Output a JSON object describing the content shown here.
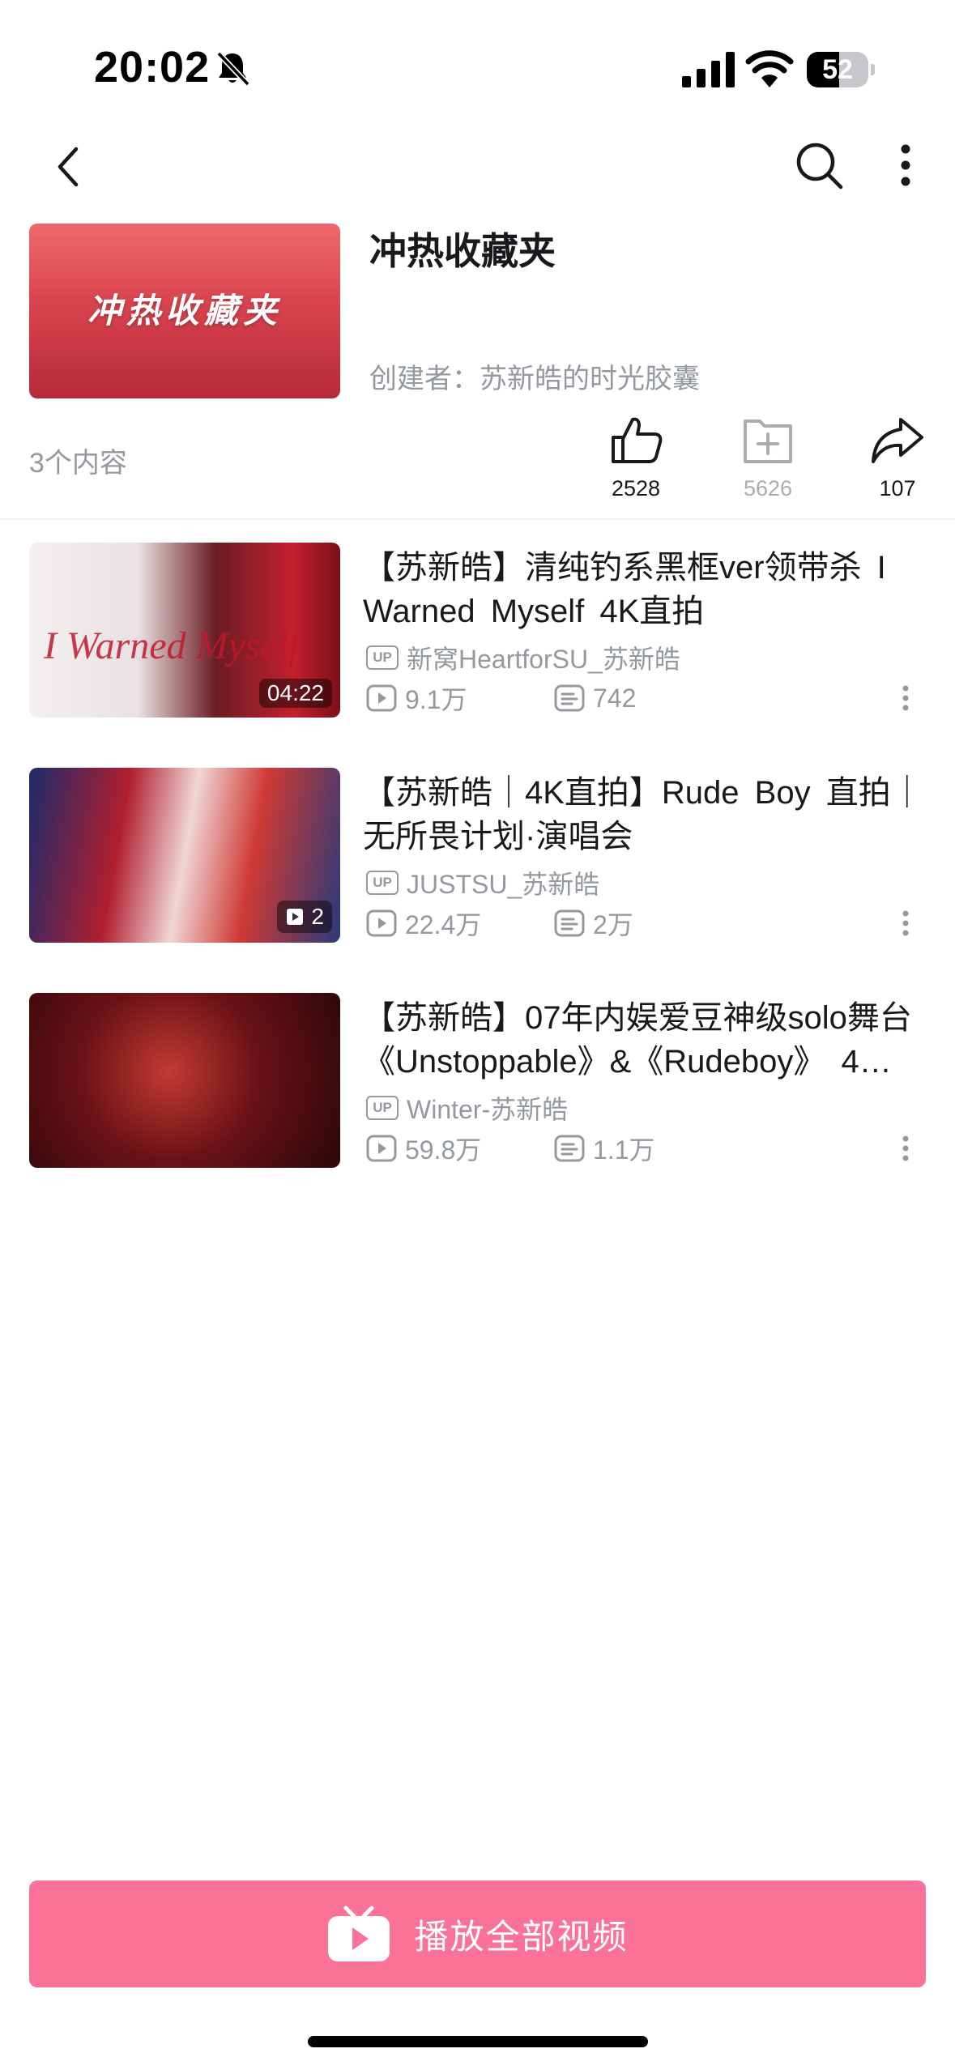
{
  "status_bar": {
    "time": "20:02",
    "battery": "52",
    "battery_level": 0.52,
    "icons": [
      "bell-muted-icon",
      "cellular-signal-icon",
      "wifi-icon",
      "battery-icon"
    ]
  },
  "nav": {
    "icons": [
      "back-arrow-icon",
      "search-icon",
      "more-vertical-icon"
    ]
  },
  "folder": {
    "cover_text": "冲热收藏夹",
    "title": "冲热收藏夹",
    "creator": "创建者：苏新皓的时光胶囊",
    "count": "3个内容",
    "likes": "2528",
    "favorites": "5626",
    "shares": "107"
  },
  "videos": [
    {
      "title": "【苏新皓】清纯钓系黑框ver领带杀 I Warned Myself 4K直拍",
      "thumb_text": "I Warned Myself",
      "duration": "04:22",
      "up_badge": "UP",
      "uploader": "新窝HeartforSU_苏新皓",
      "views": "9.1万",
      "danmaku": "742"
    },
    {
      "title": "【苏新皓｜4K直拍】Rude Boy 直拍｜无所畏计划·演唱会",
      "pages": "2",
      "up_badge": "UP",
      "uploader": "JUSTSU_苏新皓",
      "views": "22.4万",
      "danmaku": "2万"
    },
    {
      "title": "【苏新皓】07年内娱爱豆神级solo舞台《Unstoppable》&《Rudeboy》 4…",
      "up_badge": "UP",
      "uploader": "Winter-苏新皓",
      "views": "59.8万",
      "danmaku": "1.1万"
    }
  ],
  "play_all": {
    "label": "播放全部视频"
  },
  "colors": {
    "accent_pink": "#fb7299",
    "secondary_text": "#9499a0",
    "primary_text": "#18191c"
  }
}
